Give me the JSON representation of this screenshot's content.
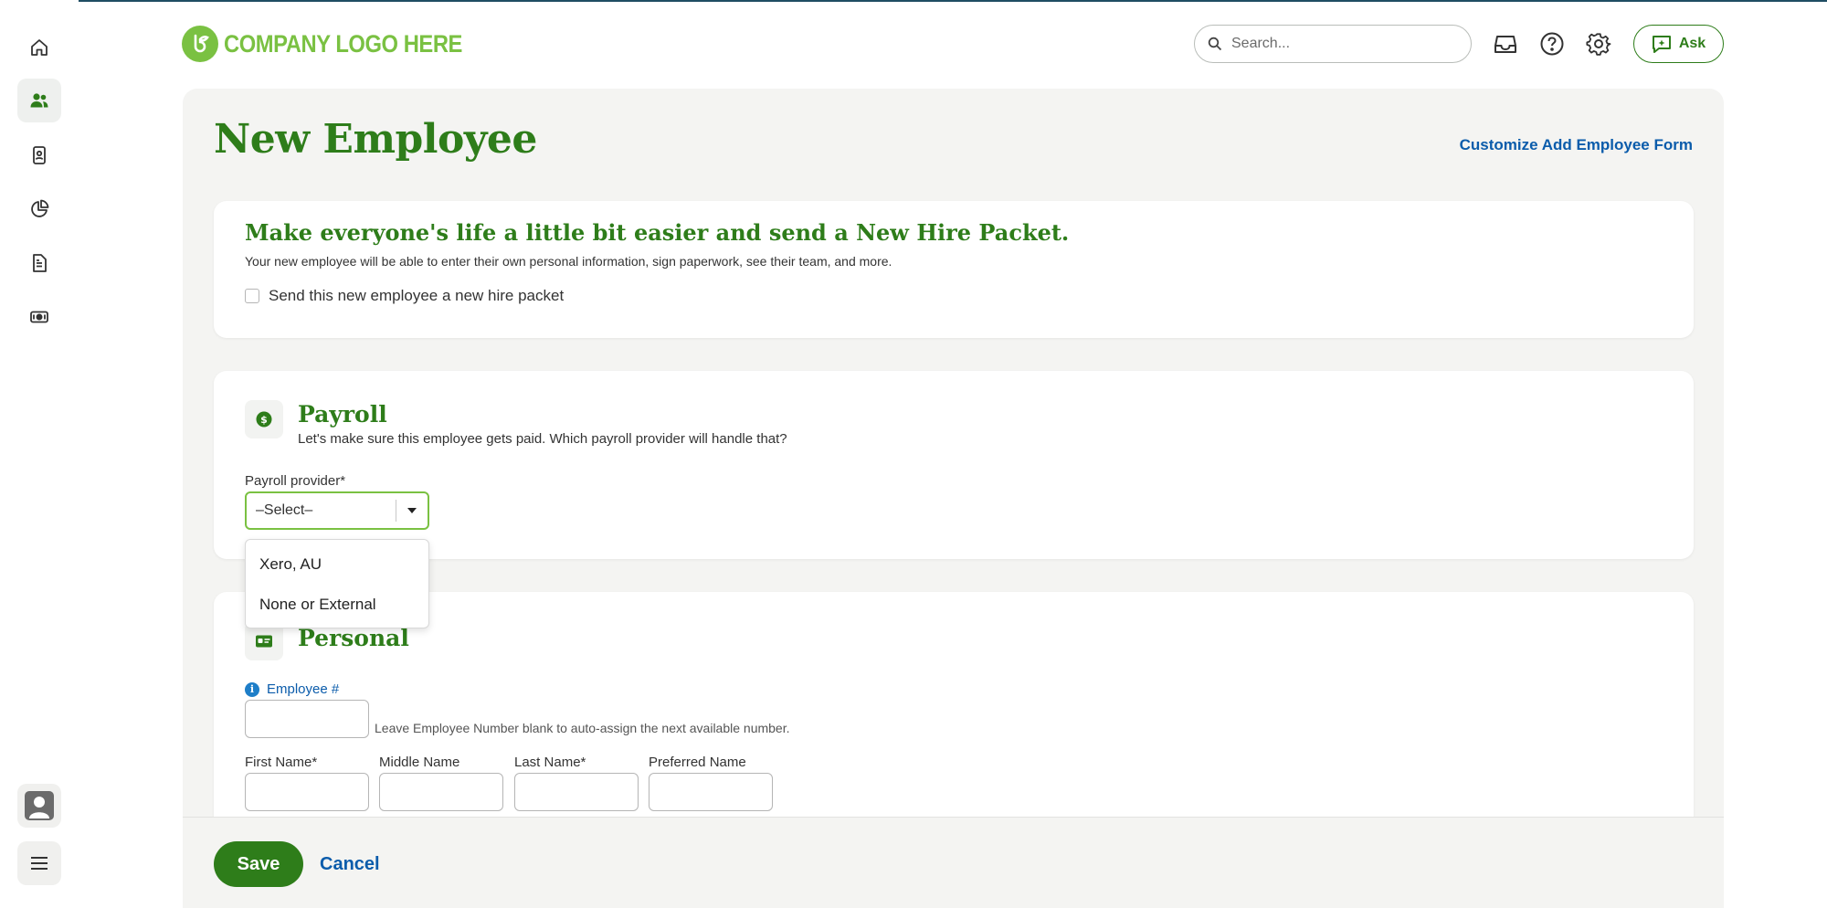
{
  "header": {
    "logo_text": "COMPANY LOGO HERE",
    "search_placeholder": "Search...",
    "ask_label": "Ask"
  },
  "nav": {
    "items": [
      "home-icon",
      "people-icon",
      "badge-icon",
      "reports-pie-icon",
      "document-icon",
      "payroll-money-icon"
    ],
    "active": "people-icon"
  },
  "page": {
    "title": "New Employee",
    "customize_link": "Customize Add Employee Form"
  },
  "hire_packet": {
    "title": "Make everyone's life a little bit easier and send a New Hire Packet.",
    "description": "Your new employee will be able to enter their own personal information, sign paperwork, see their team, and more.",
    "checkbox_label": "Send this new employee a new hire packet",
    "checked": false
  },
  "payroll": {
    "title": "Payroll",
    "subtitle": "Let's make sure this employee gets paid. Which payroll provider will handle that?",
    "provider_label": "Payroll provider*",
    "provider_value": "–Select–",
    "options": [
      "Xero, AU",
      "None or External"
    ]
  },
  "personal": {
    "title": "Personal",
    "employee_number_label": "Employee #",
    "employee_number_hint": "Leave Employee Number blank to auto-assign the next available number.",
    "first_name_label": "First Name*",
    "middle_name_label": "Middle Name",
    "last_name_label": "Last Name*",
    "preferred_name_label": "Preferred Name"
  },
  "footer": {
    "save_label": "Save",
    "cancel_label": "Cancel"
  },
  "colors": {
    "brand_green": "#2e7d1a",
    "logo_green": "#7ac142",
    "link_blue": "#0b5cab",
    "panel_bg": "#f4f4f2"
  }
}
